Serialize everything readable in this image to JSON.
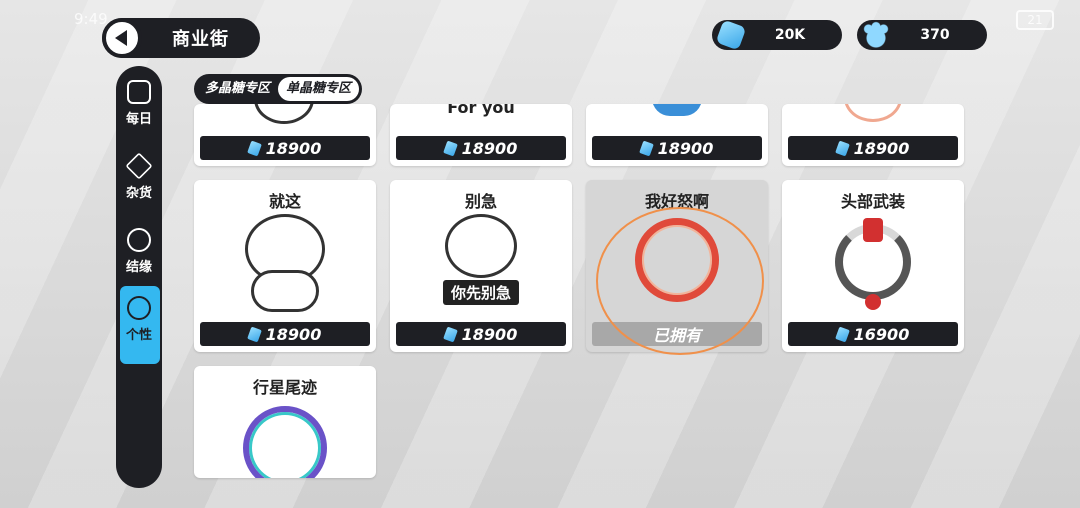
{
  "status": {
    "time": "9:49",
    "battery": "21"
  },
  "header": {
    "title": "商业街"
  },
  "currency": [
    {
      "icon": "crystal-icon",
      "value": "20K"
    },
    {
      "icon": "paw-candy-icon",
      "value": "370"
    }
  ],
  "sidebar": {
    "items": [
      {
        "label": "每日",
        "icon": "shop-icon"
      },
      {
        "label": "杂货",
        "icon": "box-icon"
      },
      {
        "label": "结缘",
        "icon": "people-icon"
      },
      {
        "label": "个性",
        "icon": "ornament-icon"
      }
    ]
  },
  "tabs": [
    {
      "label": "多晶糖专区"
    },
    {
      "label": "单晶糖专区"
    }
  ],
  "row1": [
    {
      "price": "18900"
    },
    {
      "price": "18900",
      "partial_text": "For you"
    },
    {
      "price": "18900"
    },
    {
      "price": "18900"
    }
  ],
  "row2": [
    {
      "title": "就这",
      "price": "18900"
    },
    {
      "title": "别急",
      "price": "18900",
      "sign": "你先别急"
    },
    {
      "title": "我好怒啊",
      "price": "已拥有"
    },
    {
      "title": "头部武装",
      "price": "16900"
    }
  ],
  "row3": [
    {
      "title": "行星尾迹"
    }
  ]
}
